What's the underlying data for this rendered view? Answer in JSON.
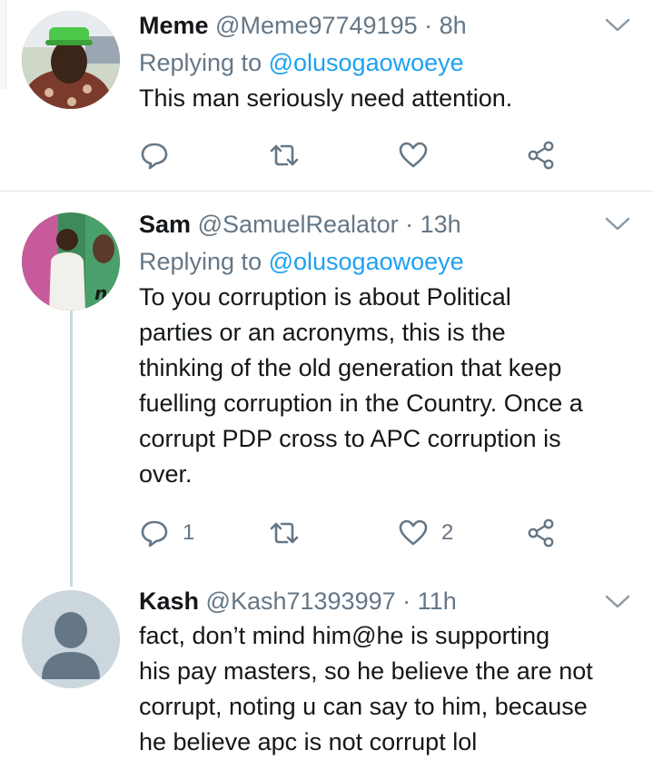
{
  "tweets": [
    {
      "name": "Meme",
      "handle": "@Meme97749195",
      "dot": "·",
      "time": "8h",
      "replying_prefix": "Replying to ",
      "replying_to": "@olusogaowoeye",
      "text": "This man seriously need attention.",
      "actions": {
        "reply_count": "",
        "retweet_count": "",
        "like_count": ""
      }
    },
    {
      "name": "Sam",
      "handle": "@SamuelRealator",
      "dot": "·",
      "time": "13h",
      "replying_prefix": "Replying to ",
      "replying_to": "@olusogaowoeye",
      "lines": [
        "To you corruption is about Political",
        "parties or an acronyms, this is the",
        "thinking of the old generation that keep",
        "fuelling corruption in the Country. Once a",
        "corrupt PDP cross to APC corruption is",
        "over."
      ],
      "actions": {
        "reply_count": "1",
        "retweet_count": "",
        "like_count": "2"
      }
    },
    {
      "name": "Kash",
      "handle": "@Kash71393997",
      "dot": "·",
      "time": "11h",
      "lines": [
        "fact, don’t mind him@he is supporting",
        "his pay masters, so he believe the are not",
        "corrupt, noting u can say to him, because",
        "he believe apc is not corrupt lol"
      ]
    }
  ],
  "colors": {
    "text": "#14171a",
    "muted": "#657786",
    "link": "#1da1f2",
    "divider": "#e1e8ed",
    "thread": "#ccd6dd"
  }
}
